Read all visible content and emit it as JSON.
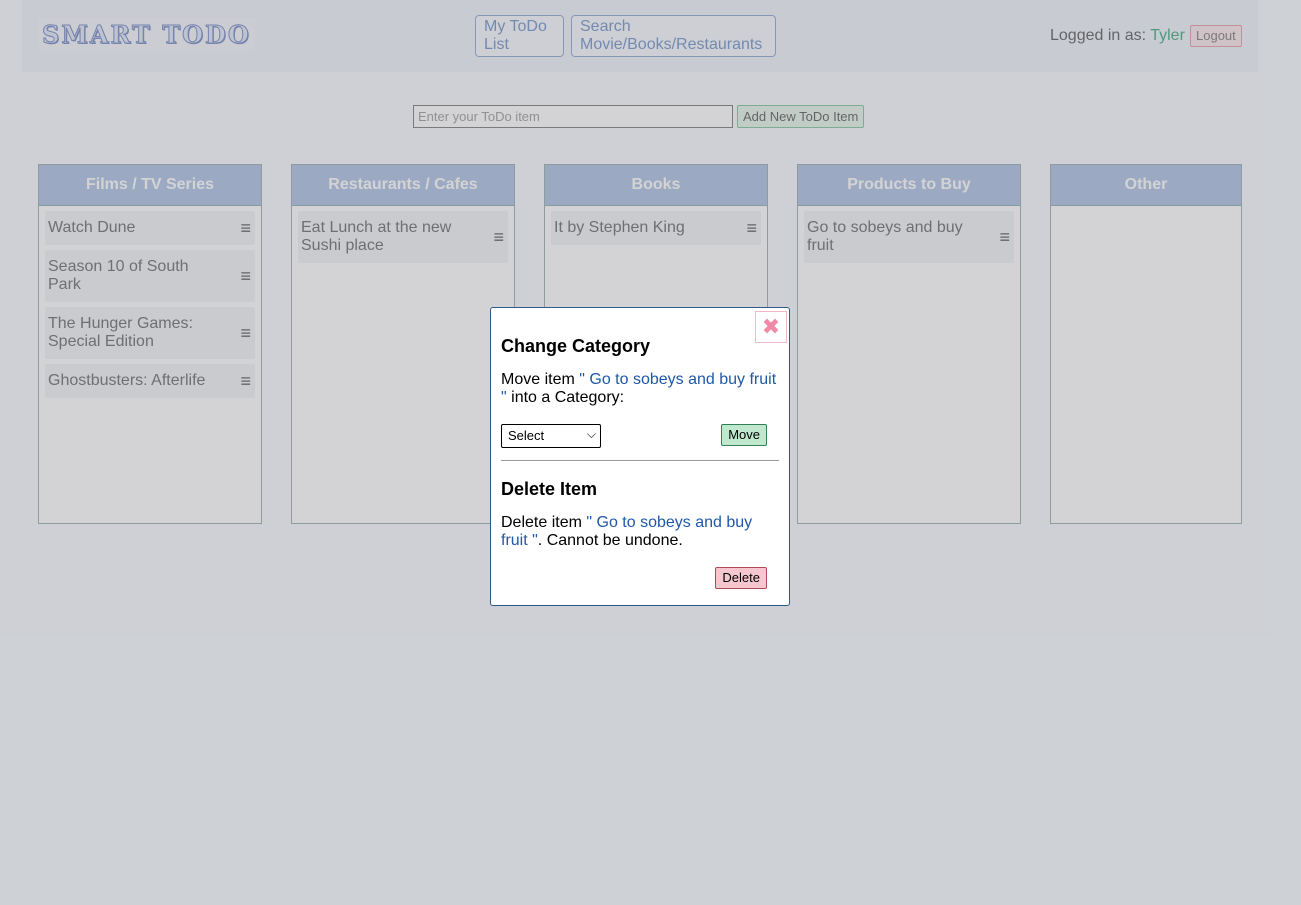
{
  "header": {
    "logo": "SMART TODO",
    "nav": [
      "My ToDo List",
      "Search Movie/Books/Restaurants"
    ],
    "logged_in_label": "Logged in as: ",
    "username": "Tyler",
    "logout": "Logout"
  },
  "add_bar": {
    "placeholder": "Enter your ToDo item",
    "button": "Add New ToDo Item"
  },
  "columns": [
    {
      "title": "Films / TV Series",
      "items": [
        "Watch Dune",
        "Season 10 of South Park",
        "The Hunger Games: Special Edition",
        "Ghostbusters: Afterlife"
      ]
    },
    {
      "title": "Restaurants / Cafes",
      "items": [
        "Eat Lunch at the new Sushi place"
      ]
    },
    {
      "title": "Books",
      "items": [
        "It by Stephen King"
      ]
    },
    {
      "title": "Products to Buy",
      "items": [
        "Go to sobeys and buy fruit"
      ]
    },
    {
      "title": "Other",
      "items": []
    }
  ],
  "icons": {
    "item_menu": "hamburger-menu-icon",
    "close": "close-x-icon"
  },
  "modal": {
    "close_glyph": "✖",
    "change_title": "Change Category",
    "move_prefix": "Move item ",
    "item_quoted": "\" Go to sobeys and buy fruit \"",
    "move_suffix": " into a Category:",
    "select_value": "Select",
    "move_button": "Move",
    "delete_title": "Delete Item",
    "delete_prefix": "Delete item ",
    "delete_suffix": ". Cannot be undone.",
    "delete_button": "Delete"
  },
  "colors": {
    "column_header": "#a9c1e2",
    "modal_border": "#2f5a8e",
    "accent_user": "#3aa576",
    "quoted_text": "#1f58a6"
  }
}
